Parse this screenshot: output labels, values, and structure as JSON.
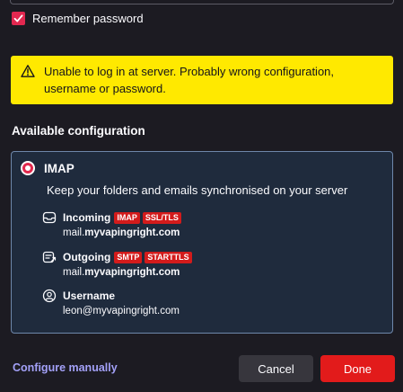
{
  "remember": {
    "label": "Remember password",
    "checked": true
  },
  "warning": {
    "icon": "warning-triangle-icon",
    "message": "Unable to log in at server. Probably wrong configuration, username or password."
  },
  "available": {
    "title": "Available configuration",
    "protocol": "IMAP",
    "description": "Keep your folders and emails synchronised on your server",
    "incoming": {
      "label": "Incoming",
      "badges": [
        "IMAP",
        "SSL/TLS"
      ],
      "host_prefix": "mail.",
      "host_domain": "myvapingright.com"
    },
    "outgoing": {
      "label": "Outgoing",
      "badges": [
        "SMTP",
        "STARTTLS"
      ],
      "host_prefix": "mail.",
      "host_domain": "myvapingright.com"
    },
    "username": {
      "label": "Username",
      "value": "leon@myvapingright.com"
    }
  },
  "footer": {
    "configure_manually": "Configure manually",
    "cancel": "Cancel",
    "done": "Done"
  },
  "colors": {
    "background": "#1c1b22",
    "warning": "#ffe900",
    "card": "#1f2b3d",
    "card_border": "#6e87aa",
    "accent_red": "#e21b1b",
    "link": "#a3a1f8"
  }
}
